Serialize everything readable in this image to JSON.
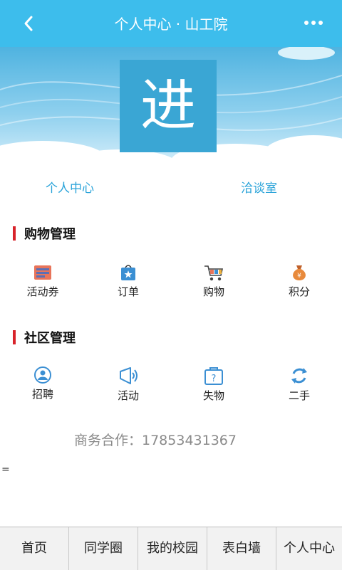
{
  "header": {
    "title": "个人中心 · 山工院",
    "back_icon": "chevron-left-icon",
    "more_icon": "more-dots-icon"
  },
  "avatar": {
    "text": "进"
  },
  "profile_tabs": [
    "个人中心",
    "洽谈室"
  ],
  "shopping": {
    "title": "购物管理",
    "items": [
      {
        "label": "活动券",
        "icon": "coupon-icon"
      },
      {
        "label": "订单",
        "icon": "order-bag-icon"
      },
      {
        "label": "购物",
        "icon": "shopping-cart-icon"
      },
      {
        "label": "积分",
        "icon": "money-bag-icon"
      }
    ]
  },
  "community": {
    "title": "社区管理",
    "items": [
      {
        "label": "招聘",
        "icon": "recruit-icon"
      },
      {
        "label": "活动",
        "icon": "megaphone-icon"
      },
      {
        "label": "失物",
        "icon": "lost-item-icon"
      },
      {
        "label": "二手",
        "icon": "recycle-icon"
      }
    ]
  },
  "business_contact": "商务合作：17853431367",
  "stray_text": "=",
  "bottom_nav": [
    "首页",
    "同学圈",
    "我的校园",
    "表白墙",
    "个人中心"
  ],
  "colors": {
    "primary": "#3dbdec",
    "accent_red": "#d8232a",
    "tab_text": "#29a3d9"
  }
}
